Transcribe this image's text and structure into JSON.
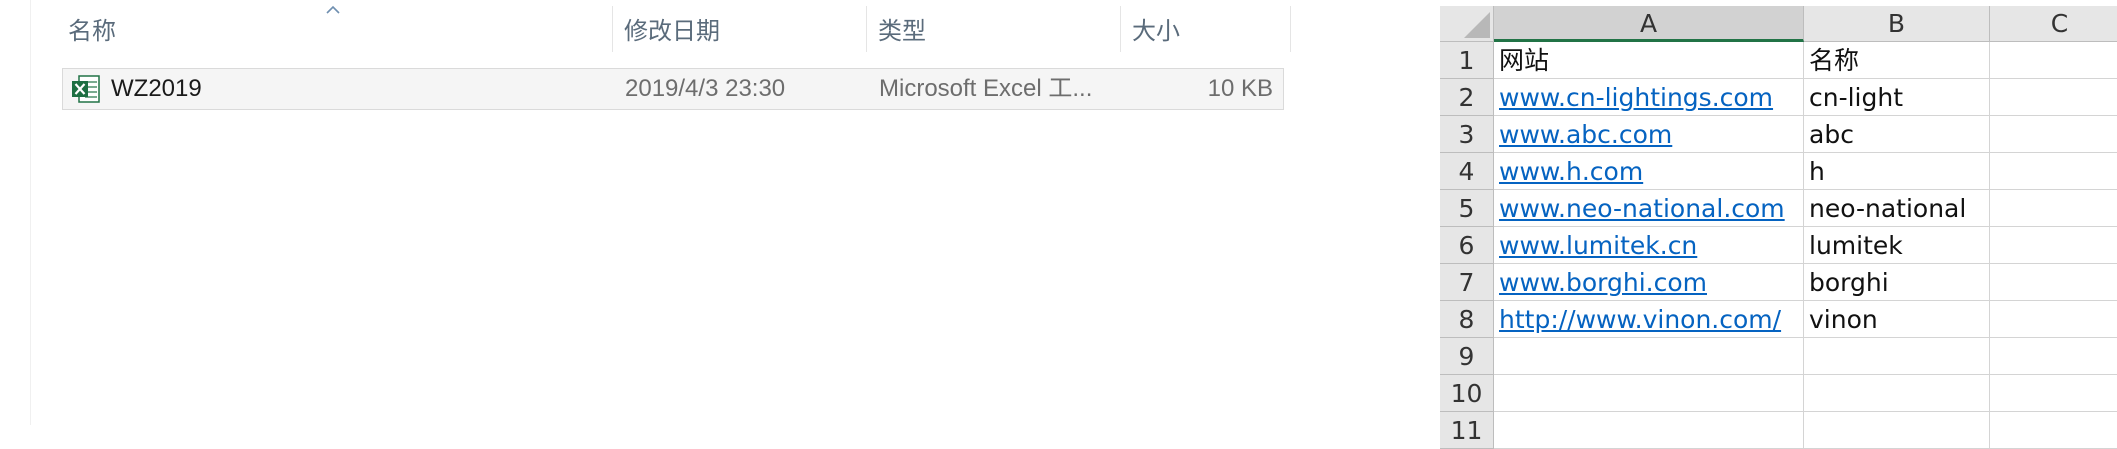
{
  "explorer": {
    "columns": {
      "name": "名称",
      "date": "修改日期",
      "type": "类型",
      "size": "大小"
    },
    "file": {
      "icon": "excel-file-icon",
      "name": "WZ2019",
      "date": "2019/4/3 23:30",
      "type": "Microsoft Excel 工...",
      "size": "10 KB"
    }
  },
  "sheet": {
    "column_headers": [
      "A",
      "B",
      "C"
    ],
    "row_numbers": [
      "1",
      "2",
      "3",
      "4",
      "5",
      "6",
      "7",
      "8",
      "9",
      "10",
      "11"
    ],
    "rows": [
      {
        "a": "网站",
        "b": "名称"
      },
      {
        "a": "www.cn-lightings.com",
        "b": "cn-light"
      },
      {
        "a": "www.abc.com",
        "b": "abc"
      },
      {
        "a": "www.h.com",
        "b": "h"
      },
      {
        "a": "www.neo-national.com",
        "b": "neo-national"
      },
      {
        "a": "www.lumitek.cn",
        "b": "lumitek"
      },
      {
        "a": "www.borghi.com",
        "b": "borghi"
      },
      {
        "a": "http://www.vinon.com/",
        "b": "vinon"
      },
      {
        "a": "",
        "b": ""
      },
      {
        "a": "",
        "b": ""
      },
      {
        "a": "",
        "b": ""
      }
    ],
    "colors": {
      "hyperlink": "#0563c1",
      "header_bg": "#e6e6e6",
      "active_column_accent": "#217346"
    }
  }
}
